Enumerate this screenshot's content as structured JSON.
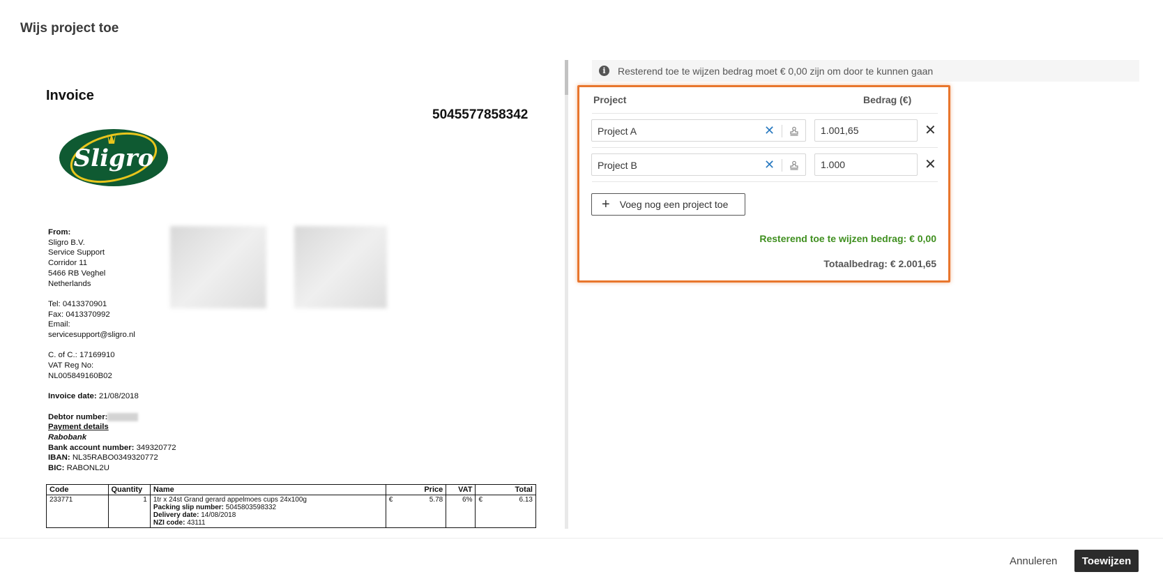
{
  "modal": {
    "title": "Wijs project toe"
  },
  "invoice": {
    "title": "Invoice",
    "number": "5045577858342",
    "logo_text": "Sligro",
    "from_label": "From:",
    "from_lines": [
      "Sligro B.V.",
      "Service Support",
      "Corridor 11",
      "5466 RB Veghel",
      "Netherlands"
    ],
    "tel": "Tel: 0413370901",
    "fax": "Fax: 0413370992",
    "email_label": "Email:",
    "email": "servicesupport@sligro.nl",
    "coc": "C. of C.: 17169910",
    "vat_label": "VAT Reg No:",
    "vat": "NL005849160B02",
    "date_label": "Invoice date:",
    "date": "21/08/2018",
    "debtor_label": "Debtor number:",
    "payment_label": "Payment details",
    "bank": "Rabobank",
    "account_label": "Bank account number:",
    "account": "349320772",
    "iban_label": "IBAN:",
    "iban": "NL35RABO0349320772",
    "bic_label": "BIC:",
    "bic": "RABONL2U",
    "table": {
      "headers": [
        "Code",
        "Quantity",
        "Name",
        "Price",
        "VAT",
        "Total"
      ],
      "row": {
        "code": "233771",
        "quantity": "1",
        "name": "1tr x 24st Grand gerard appelmoes cups 24x100g",
        "packing_label": "Packing slip number:",
        "packing": "5045803598332",
        "delivery_label": "Delivery date:",
        "delivery": "14/08/2018",
        "nzi_label": "NZI code:",
        "nzi": "43111",
        "currency": "€",
        "price": "5.78",
        "vat": "6%",
        "total": "6.13"
      }
    }
  },
  "info": {
    "message": "Resterend toe te wijzen bedrag moet € 0,00 zijn om door te kunnen gaan"
  },
  "allocation": {
    "col_project": "Project",
    "col_amount": "Bedrag (€)",
    "rows": [
      {
        "project": "Project A",
        "amount": "1.001,65"
      },
      {
        "project": "Project B",
        "amount": "1.000"
      }
    ],
    "add_label": "Voeg nog een project toe",
    "remaining": "Resterend toe te wijzen bedrag: € 0,00",
    "total": "Totaalbedrag: € 2.001,65"
  },
  "footer": {
    "cancel": "Annuleren",
    "assign": "Toewijzen"
  },
  "colors": {
    "accent": "#e8762d",
    "success": "#3f8f1f",
    "link": "#2a7ac0",
    "primary_button": "#2b2b2b"
  }
}
